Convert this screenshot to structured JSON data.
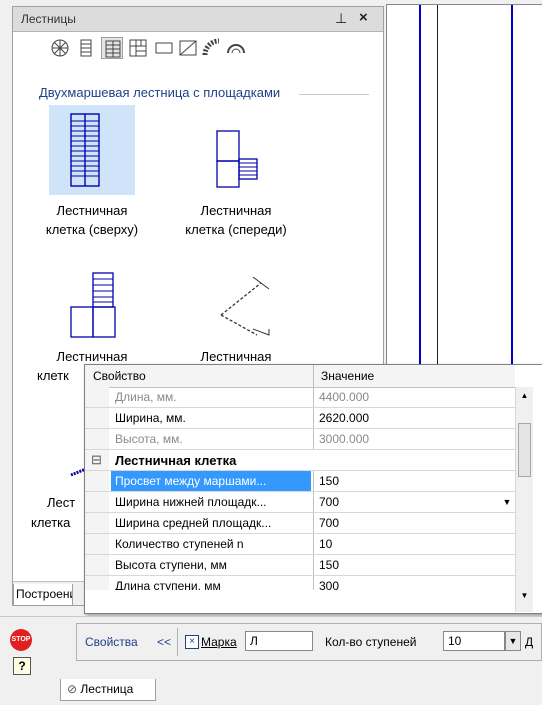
{
  "panel": {
    "title": "Лестницы",
    "pin": "⊥",
    "close": "×",
    "group_label": "Двухмаршевая лестница с площадками",
    "items": [
      {
        "line1": "Лестничная",
        "line2": "клетка (сверху)"
      },
      {
        "line1": "Лестничная",
        "line2": "клетка (спереди)"
      },
      {
        "line1": "Лестничная",
        "line2": "клетк"
      },
      {
        "line1": "Лестничная",
        "line2": ""
      },
      {
        "line1": "Лест",
        "line2": "клетка"
      }
    ],
    "bottom_tab": "Построение"
  },
  "toolbar_icons": [
    "spiral-stair-icon",
    "single-flight-icon",
    "two-flight-plan-icon",
    "stair-grid-icon",
    "rectangle-icon",
    "ramp-icon",
    "curved-stair-icon",
    "arc-icon"
  ],
  "props": {
    "header": {
      "col1": "Свойство",
      "col2": "Значение"
    },
    "rows": [
      {
        "name": "Длина, мм.",
        "value": "4400.000",
        "disabled": true
      },
      {
        "name": "Ширина, мм.",
        "value": "2620.000",
        "disabled": false
      },
      {
        "name": "Высота, мм.",
        "value": "3000.000",
        "disabled": true
      },
      {
        "name": "Лестничная клетка",
        "value": "",
        "category": true,
        "toggle": "⊟"
      },
      {
        "name": "Просвет между маршами...",
        "value": "150",
        "selected": true
      },
      {
        "name": "Ширина нижней площадк...",
        "value": "700"
      },
      {
        "name": "Ширина средней площадк...",
        "value": "700"
      },
      {
        "name": "Количество ступеней n",
        "value": "10"
      },
      {
        "name": "Высота ступени, мм",
        "value": "150"
      },
      {
        "name": "Длина ступени, мм",
        "value": "300"
      }
    ]
  },
  "bottombar": {
    "stop": "STOP",
    "help": "?",
    "props_label": "Свойства",
    "arrows": "<<",
    "checkbox_mark": "×",
    "marka_label": "Марка",
    "marka_value": "Л",
    "steps_label": "Кол-во ступеней",
    "steps_value": "10",
    "trailing": "Д",
    "tab_label": "Лестница"
  },
  "colors": {
    "accent": "#1f3f8a",
    "selection": "#3399ff",
    "drawing_line": "#0000cc"
  }
}
